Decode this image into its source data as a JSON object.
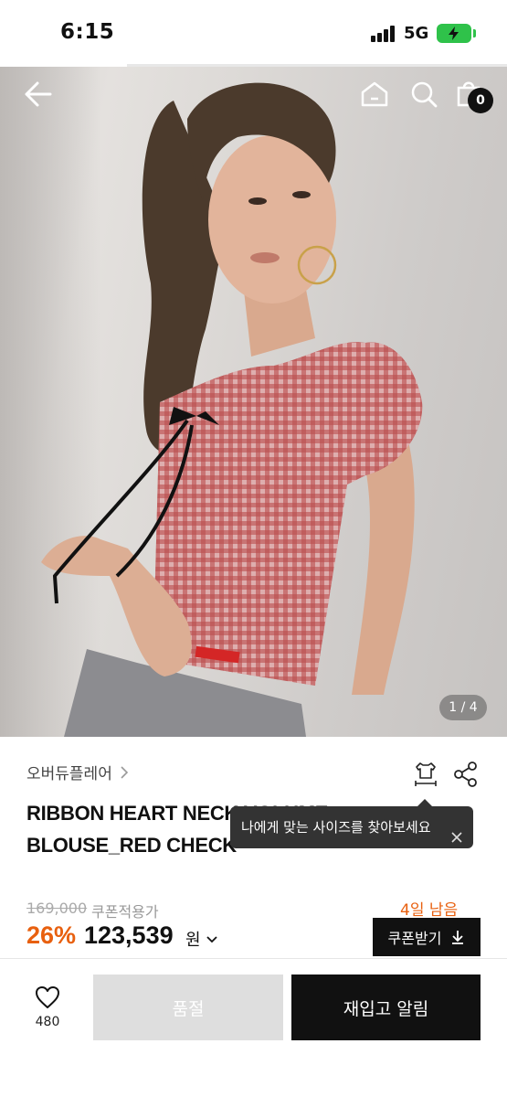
{
  "status_bar": {
    "time": "6:15",
    "network": "5G",
    "battery_color": "#2fc24a"
  },
  "gallery": {
    "page_indicator": "1 / 4",
    "current_page": 1,
    "total_pages": 4,
    "cart_count": "0",
    "icons": [
      "back-arrow-icon",
      "home-icon",
      "search-icon",
      "shopping-bag-icon"
    ]
  },
  "product": {
    "brand": "오버듀플레어",
    "title": "RIBBON HEART NECK VOLUME BLOUSE_RED CHECK",
    "size_tooltip": "나에게 맞는 사이즈를 찾아보세요",
    "original_price": "169,000",
    "coupon_price_label": "쿠폰적용가",
    "days_left": "4일 남음",
    "discount": "26%",
    "price": "123,539",
    "currency": "원",
    "coupon_button": "쿠폰받기"
  },
  "bottom_bar": {
    "like_count": "480",
    "soldout_label": "품절",
    "restock_label": "재입고 알림"
  },
  "colors": {
    "accent": "#e8600f",
    "primary": "#111111",
    "disabled": "#dedede"
  }
}
